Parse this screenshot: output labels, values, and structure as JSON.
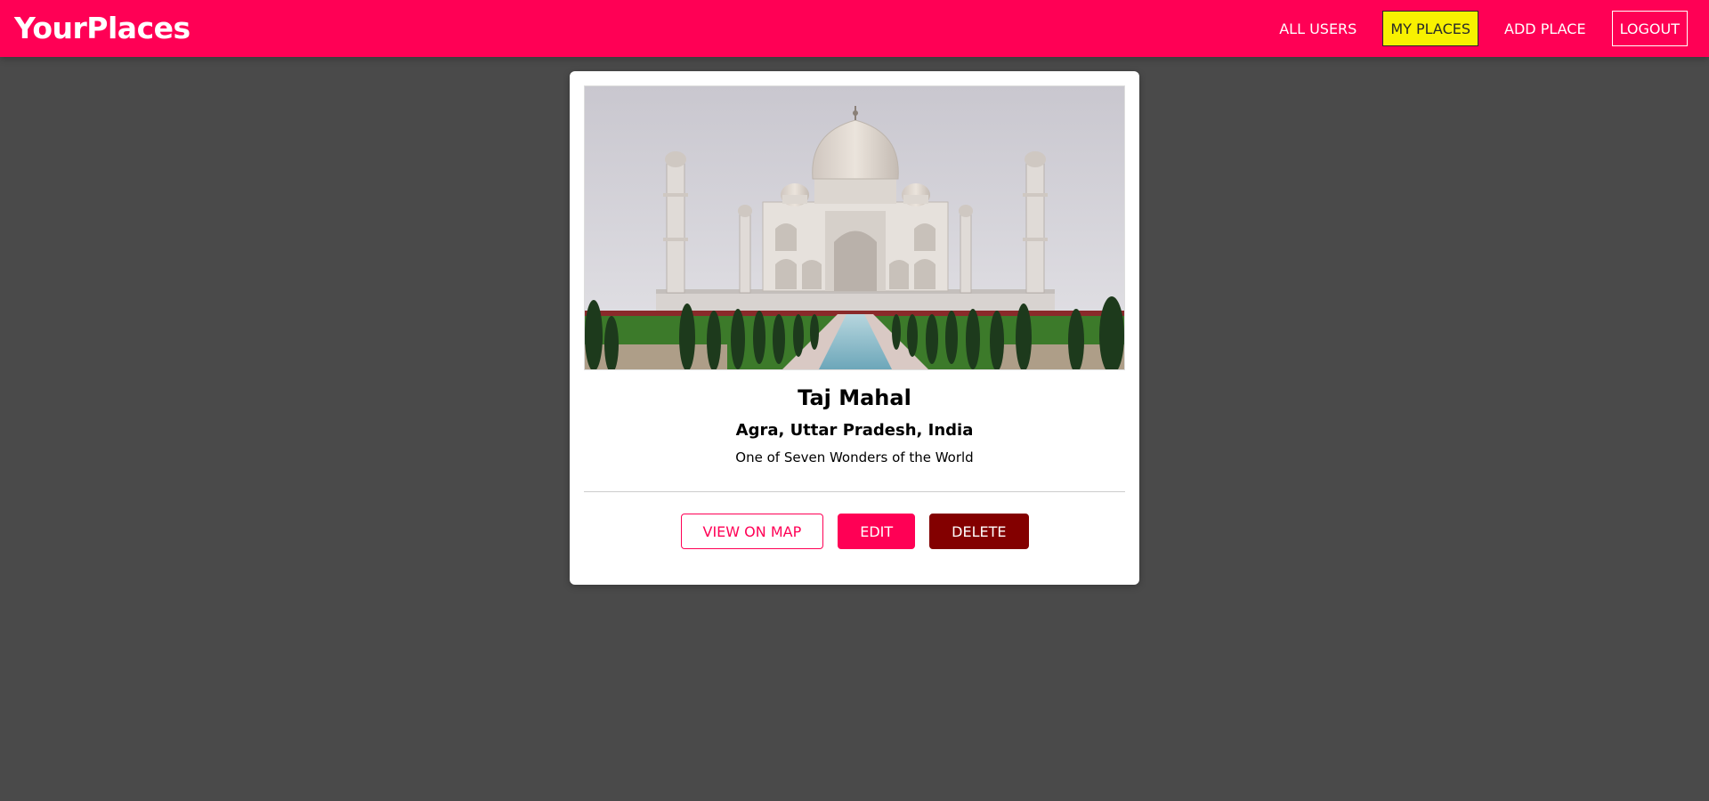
{
  "header": {
    "logo": "YourPlaces",
    "nav": [
      {
        "label": "ALL USERS"
      },
      {
        "label": "MY PLACES"
      },
      {
        "label": "ADD PLACE"
      },
      {
        "label": "LOGOUT"
      }
    ]
  },
  "place": {
    "image_icon": "taj-mahal-photo",
    "title": "Taj Mahal",
    "address": "Agra, Uttar Pradesh, India",
    "description": "One of Seven Wonders of the World"
  },
  "actions": {
    "view_on_map": "VIEW ON MAP",
    "edit": "EDIT",
    "delete": "DELETE"
  },
  "colors": {
    "brand": "#ff0055",
    "active_nav": "#f8f100",
    "danger": "#830000",
    "background": "#4a4a4a"
  }
}
